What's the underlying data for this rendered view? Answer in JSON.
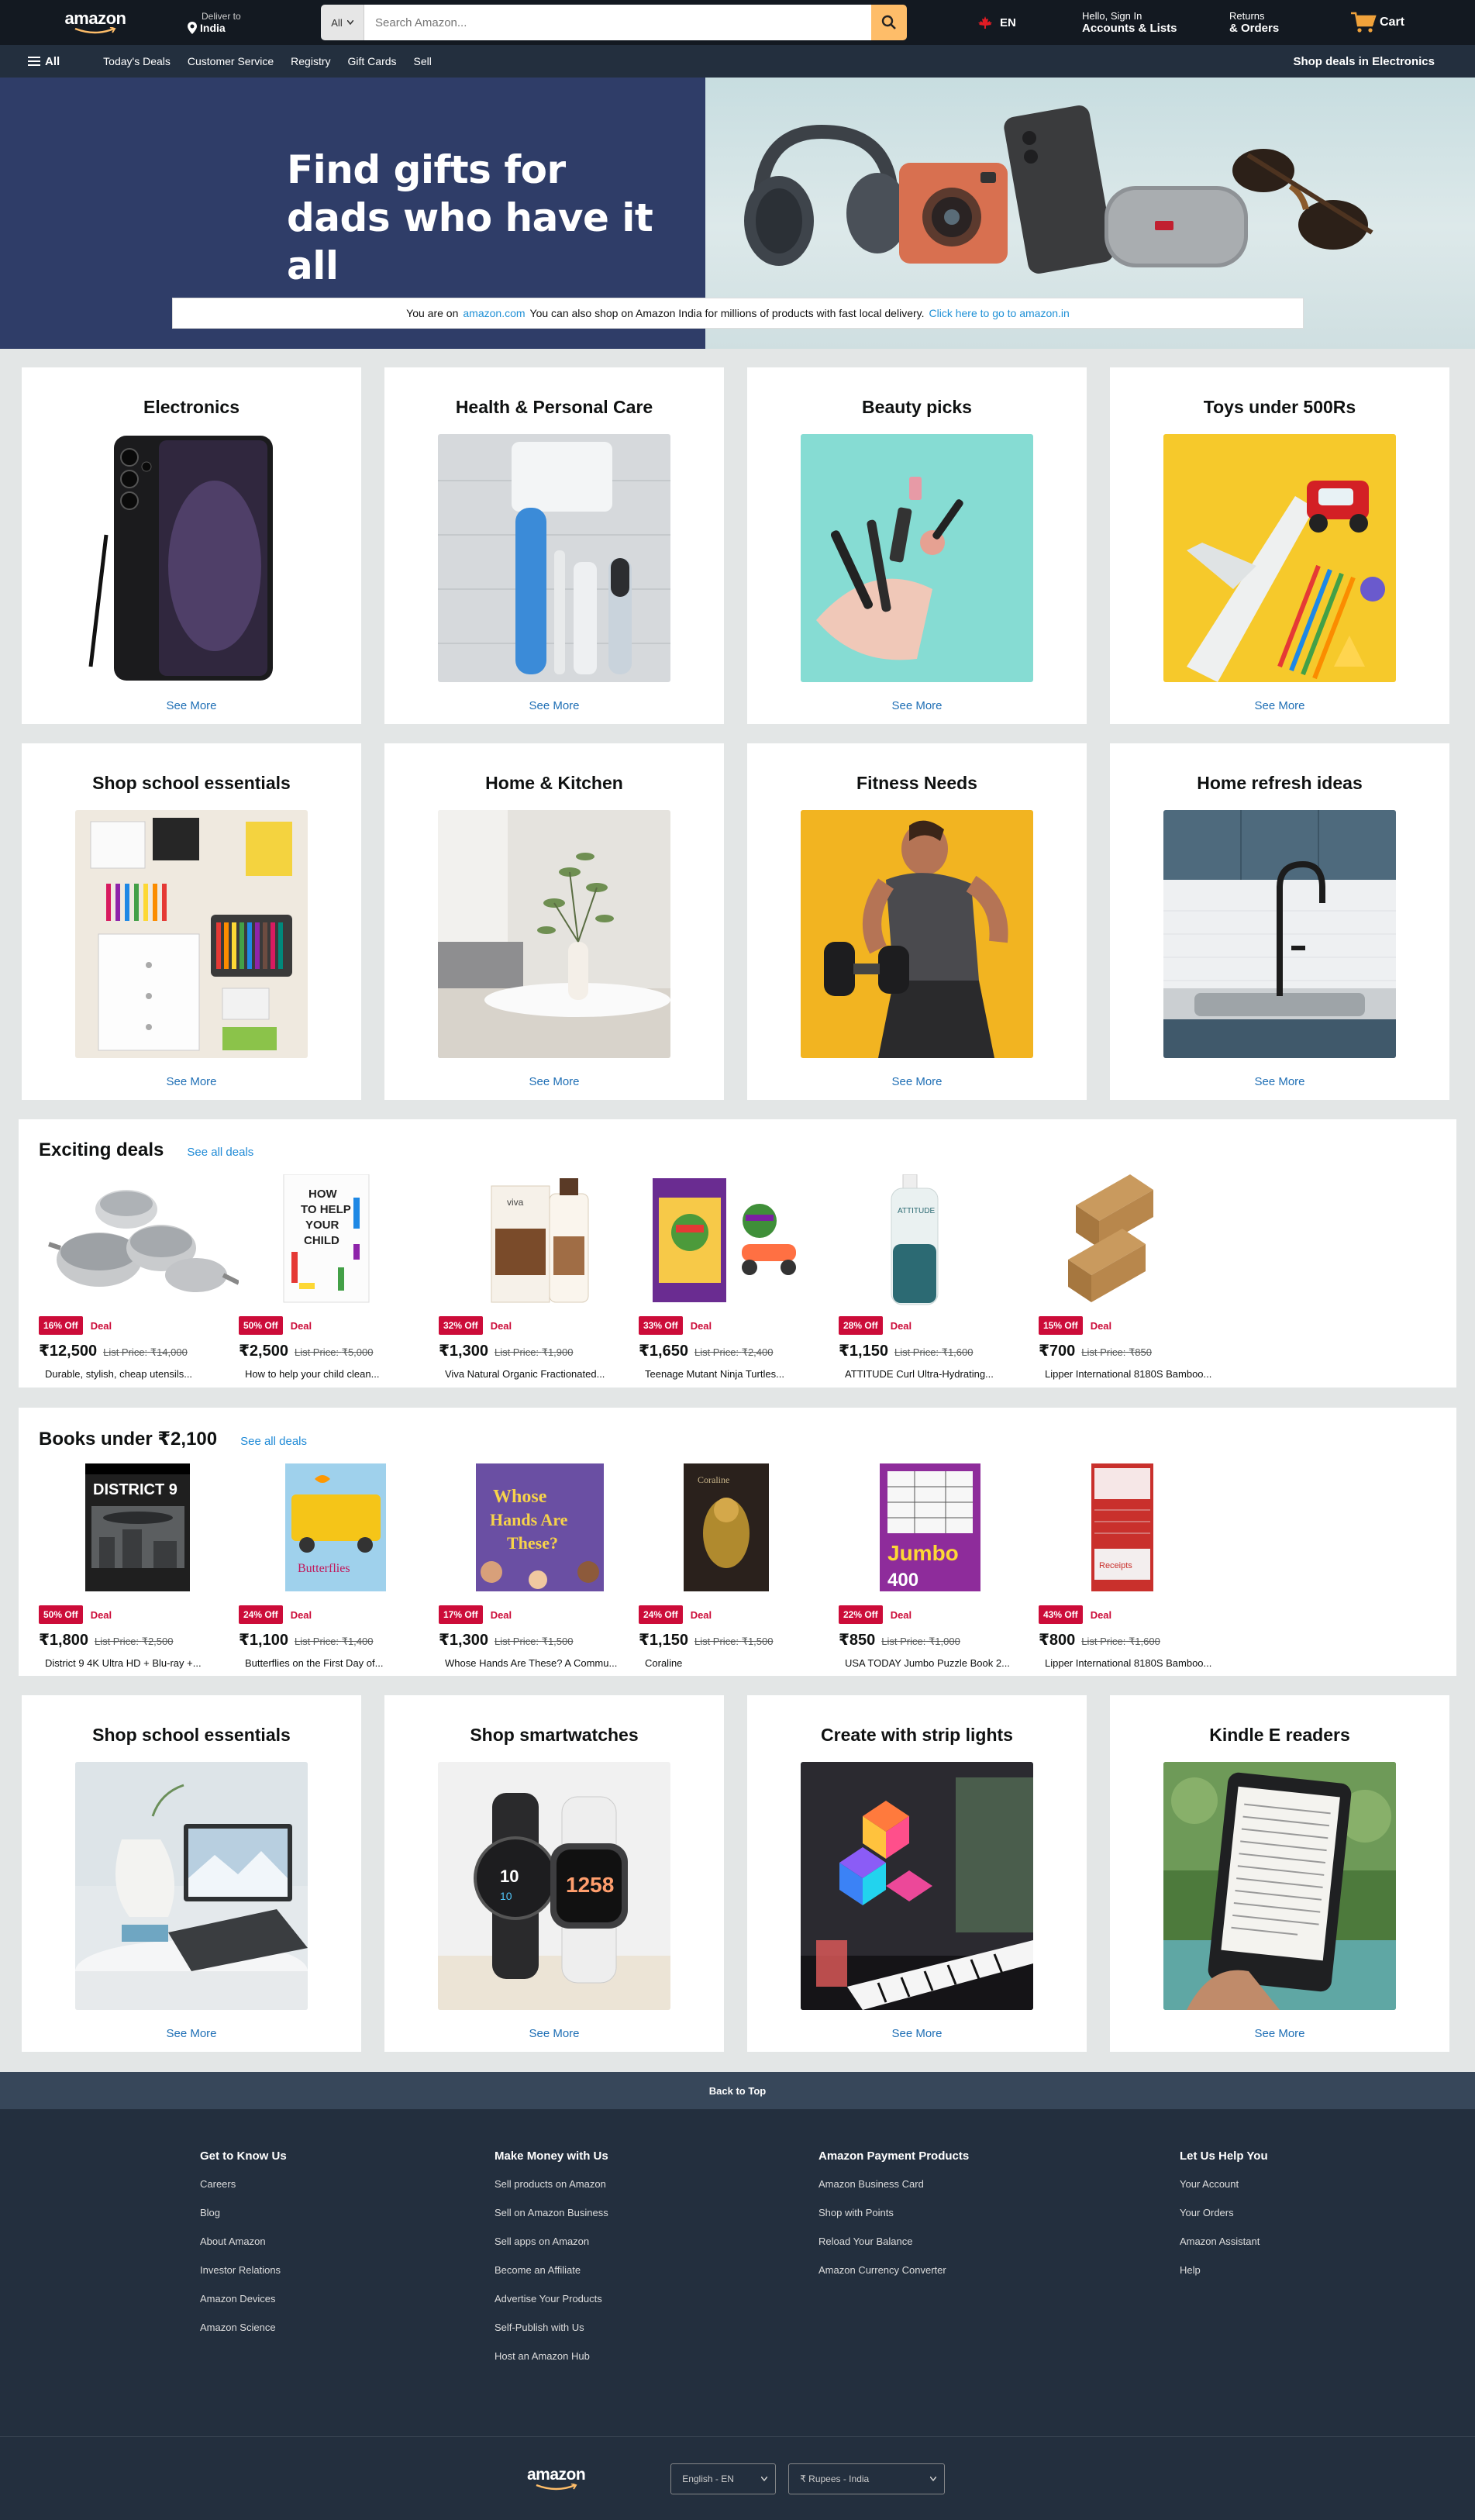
{
  "nav": {
    "logo": "amazon",
    "deliver_line1": "Deliver to",
    "deliver_line2": "India",
    "search_category": "All",
    "search_placeholder": "Search Amazon...",
    "lang": "EN",
    "account_line1": "Hello, Sign In",
    "account_line2": "Accounts & Lists",
    "returns_line1": "Returns",
    "returns_line2": "& Orders",
    "cart": "Cart"
  },
  "subnav": {
    "all": "All",
    "links": [
      "Today's Deals",
      "Customer Service",
      "Registry",
      "Gift Cards",
      "Sell"
    ],
    "right": "Shop deals in Electronics"
  },
  "hero": {
    "title_line1": "Find gifts for",
    "title_line2": "dads who have it all",
    "notice_pre": "You are on",
    "notice_site": "amazon.com",
    "notice_mid": "You can also shop on Amazon India for millions of products with fast local delivery.",
    "notice_link": "Click here to go to amazon.in"
  },
  "cards_row1": [
    {
      "title": "Electronics",
      "link": "See More"
    },
    {
      "title": "Health & Personal Care",
      "link": "See More"
    },
    {
      "title": "Beauty picks",
      "link": "See More"
    },
    {
      "title": "Toys under 500Rs",
      "link": "See More"
    }
  ],
  "cards_row2": [
    {
      "title": "Shop school essentials",
      "link": "See More"
    },
    {
      "title": "Home & Kitchen",
      "link": "See More"
    },
    {
      "title": "Fitness Needs",
      "link": "See More"
    },
    {
      "title": "Home refresh ideas",
      "link": "See More"
    }
  ],
  "deals1": {
    "title": "Exciting deals",
    "see_all": "See all deals",
    "items": [
      {
        "discount": "16% Off",
        "label": "Deal",
        "price": "₹12,500",
        "list_label": "List Price:",
        "list_price": "₹14,000",
        "name": "Durable, stylish, cheap utensils..."
      },
      {
        "discount": "50% Off",
        "label": "Deal",
        "price": "₹2,500",
        "list_label": "List Price:",
        "list_price": "₹5,000",
        "name": "How to help your child clean..."
      },
      {
        "discount": "32% Off",
        "label": "Deal",
        "price": "₹1,300",
        "list_label": "List Price:",
        "list_price": "₹1,900",
        "name": "Viva Natural Organic Fractionated..."
      },
      {
        "discount": "33% Off",
        "label": "Deal",
        "price": "₹1,650",
        "list_label": "List Price:",
        "list_price": "₹2,400",
        "name": "Teenage Mutant Ninja Turtles..."
      },
      {
        "discount": "28% Off",
        "label": "Deal",
        "price": "₹1,150",
        "list_label": "List Price:",
        "list_price": "₹1,600",
        "name": "ATTITUDE Curl Ultra-Hydrating..."
      },
      {
        "discount": "15% Off",
        "label": "Deal",
        "price": "₹700",
        "list_label": "List Price:",
        "list_price": "₹850",
        "name": "Lipper International 8180S Bamboo..."
      }
    ]
  },
  "deals2": {
    "title": "Books under ₹2,100",
    "see_all": "See all deals",
    "items": [
      {
        "discount": "50% Off",
        "label": "Deal",
        "price": "₹1,800",
        "list_label": "List Price:",
        "list_price": "₹2,500",
        "name": "District 9 4K Ultra HD + Blu-ray +..."
      },
      {
        "discount": "24% Off",
        "label": "Deal",
        "price": "₹1,100",
        "list_label": "List Price:",
        "list_price": "₹1,400",
        "name": "Butterflies on the First Day of..."
      },
      {
        "discount": "17% Off",
        "label": "Deal",
        "price": "₹1,300",
        "list_label": "List Price:",
        "list_price": "₹1,500",
        "name": "Whose Hands Are These? A Commu..."
      },
      {
        "discount": "24% Off",
        "label": "Deal",
        "price": "₹1,150",
        "list_label": "List Price:",
        "list_price": "₹1,500",
        "name": "Coraline"
      },
      {
        "discount": "22% Off",
        "label": "Deal",
        "price": "₹850",
        "list_label": "List Price:",
        "list_price": "₹1,000",
        "name": "USA TODAY Jumbo Puzzle Book 2..."
      },
      {
        "discount": "43% Off",
        "label": "Deal",
        "price": "₹800",
        "list_label": "List Price:",
        "list_price": "₹1,600",
        "name": "Lipper International 8180S Bamboo..."
      }
    ]
  },
  "cards_row3": [
    {
      "title": "Shop school essentials",
      "link": "See More"
    },
    {
      "title": "Shop smartwatches",
      "link": "See More"
    },
    {
      "title": "Create with strip lights",
      "link": "See More"
    },
    {
      "title": "Kindle E readers",
      "link": "See More"
    }
  ],
  "footer": {
    "back_to_top": "Back to Top",
    "columns": [
      {
        "heading": "Get to Know Us",
        "links": [
          "Careers",
          "Blog",
          "About Amazon",
          "Investor Relations",
          "Amazon Devices",
          "Amazon Science"
        ]
      },
      {
        "heading": "Make Money with Us",
        "links": [
          "Sell products on Amazon",
          "Sell on Amazon Business",
          "Sell apps on Amazon",
          "Become an Affiliate",
          "Advertise Your Products",
          "Self-Publish with Us",
          "Host an Amazon Hub"
        ]
      },
      {
        "heading": "Amazon Payment Products",
        "links": [
          "Amazon Business Card",
          "Shop with Points",
          "Reload Your Balance",
          "Amazon Currency Converter"
        ]
      },
      {
        "heading": "Let Us Help You",
        "links": [
          "Your Account",
          "Your Orders",
          "Amazon Assistant",
          "Help"
        ]
      }
    ],
    "logo": "amazon",
    "language": "English - EN",
    "currency": "₹ Rupees - India"
  },
  "colors": {
    "nav_dark": "#131921",
    "nav_sub": "#232f3e",
    "search_button": "#febd69",
    "deal_red": "#cc0c39",
    "link_blue": "#1f8ad6",
    "hero_left": "#2f3d68"
  }
}
